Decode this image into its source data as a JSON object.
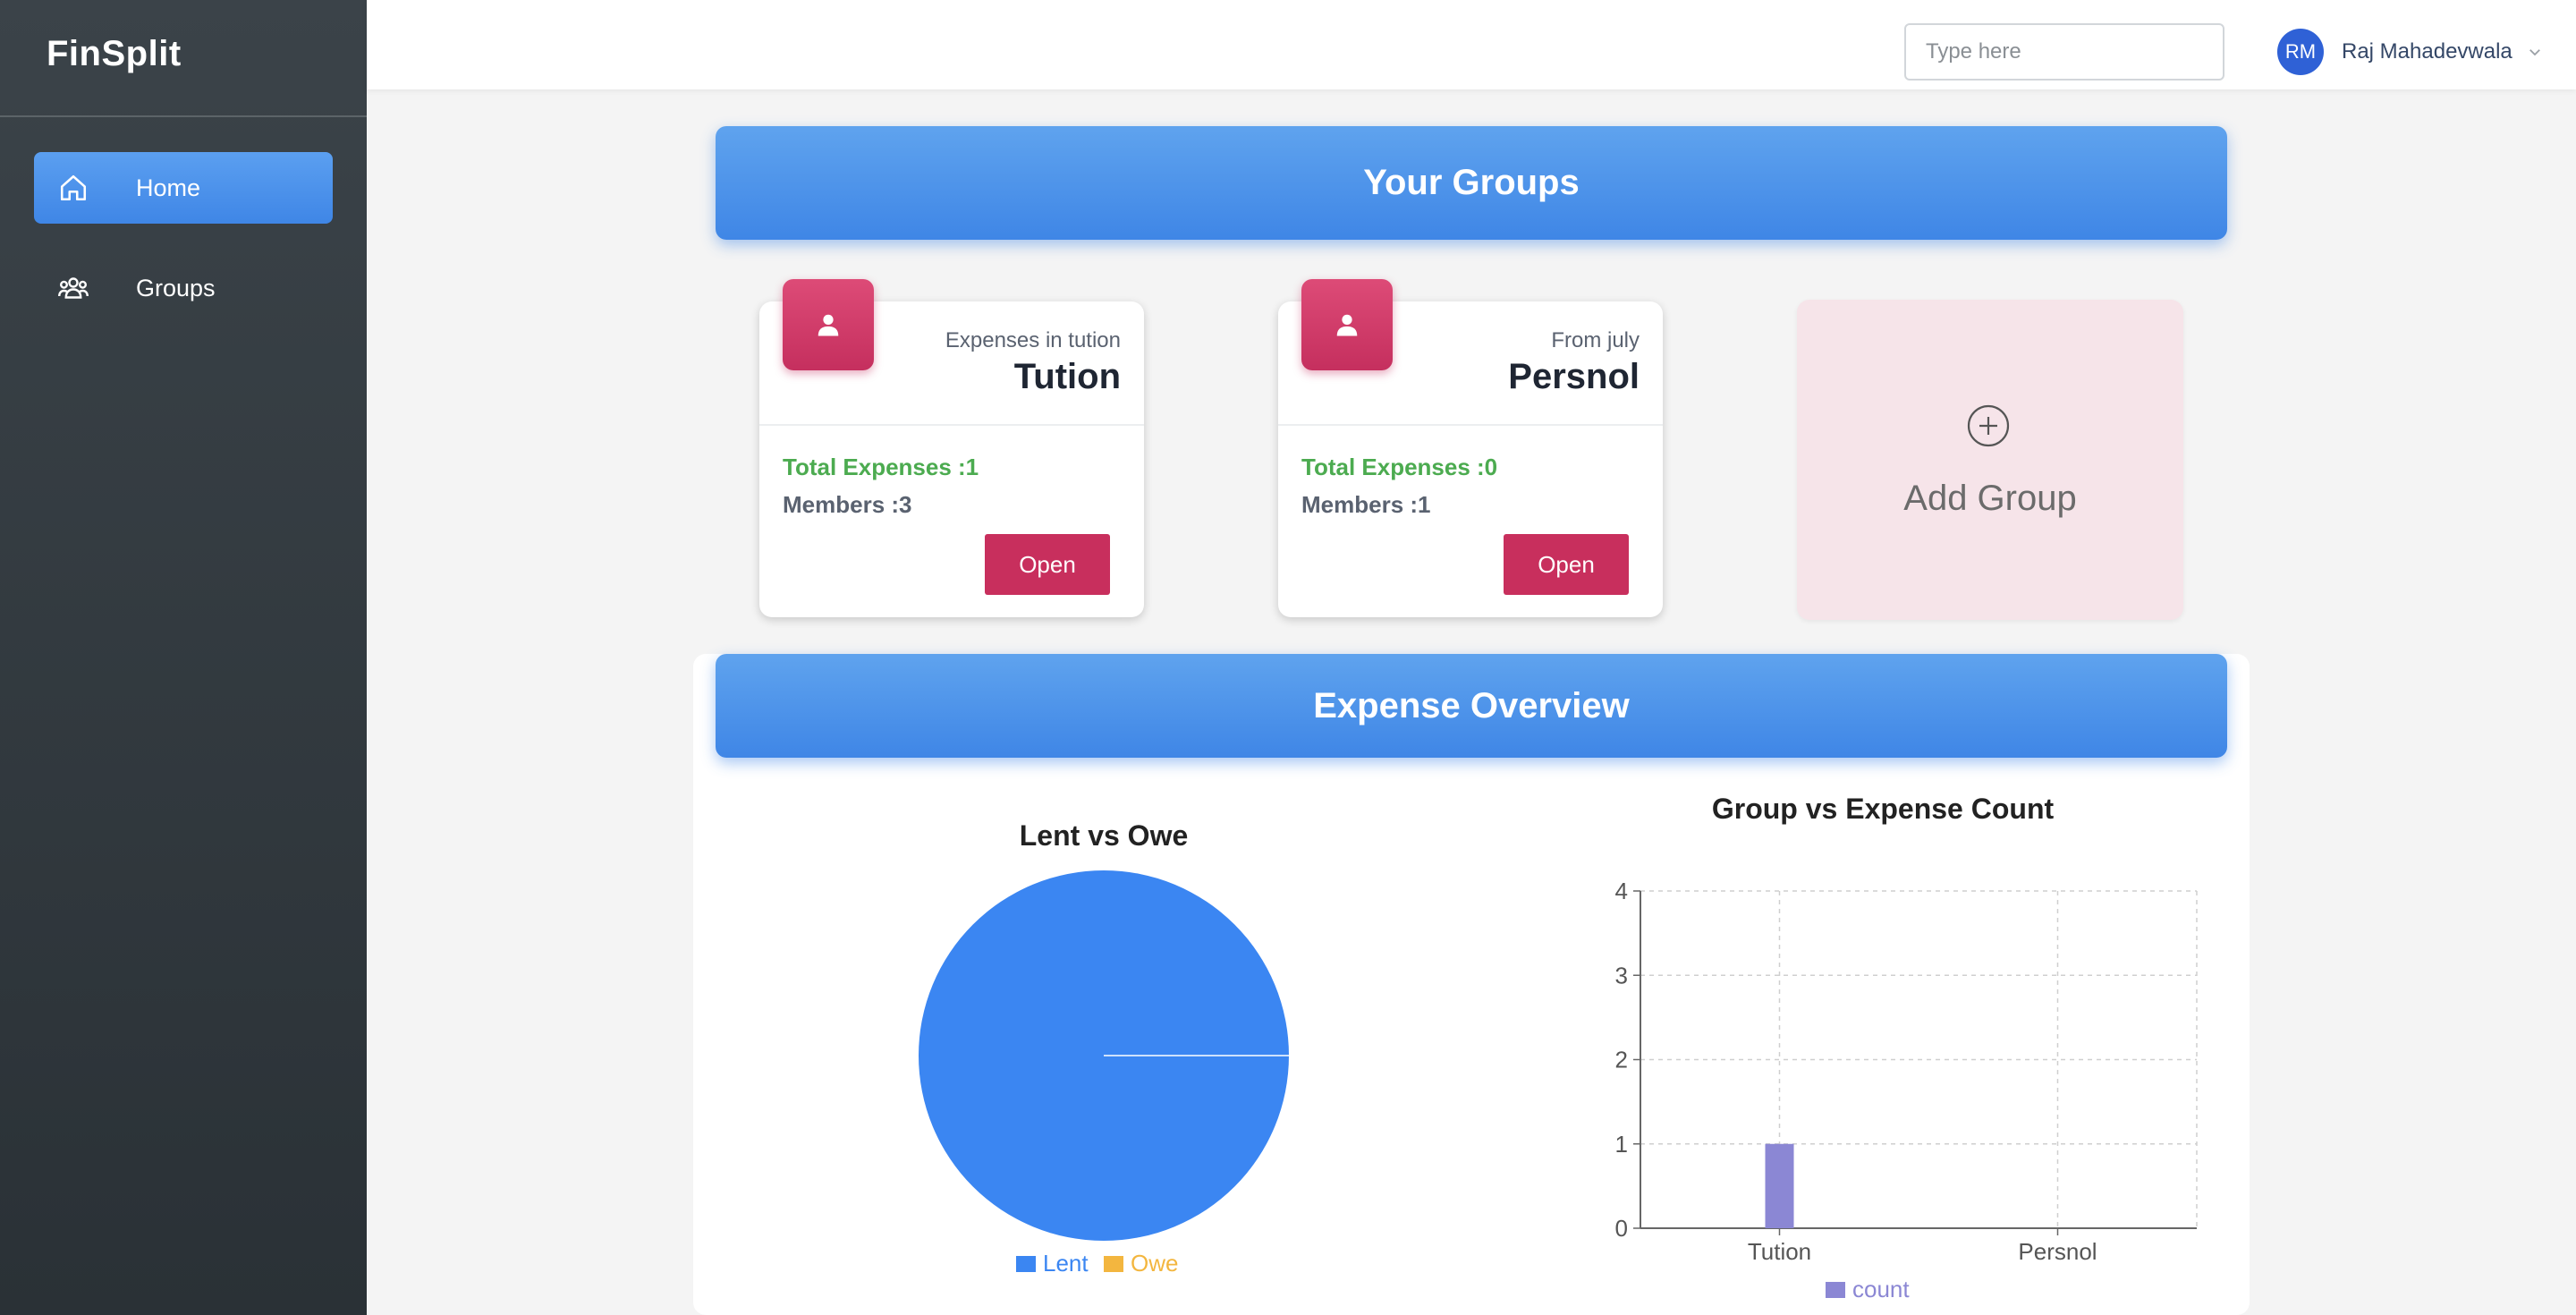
{
  "sidebar": {
    "brand": "FinSplit",
    "items": [
      {
        "label": "Home",
        "icon": "home-icon",
        "active": true
      },
      {
        "label": "Groups",
        "icon": "people-icon",
        "active": false
      }
    ]
  },
  "topbar": {
    "search_placeholder": "Type here",
    "user_initials": "RM",
    "user_name": "Raj Mahadevwala"
  },
  "groups_section": {
    "title": "Your Groups",
    "groups": [
      {
        "subtitle": "Expenses in tution",
        "name": "Tution",
        "total_expenses": "Total Expenses :1",
        "members": "Members :3",
        "open_label": "Open"
      },
      {
        "subtitle": "From july",
        "name": "Persnol",
        "total_expenses": "Total Expenses :0",
        "members": "Members :1",
        "open_label": "Open"
      }
    ],
    "add_group_label": "Add Group"
  },
  "overview": {
    "title": "Expense Overview"
  },
  "colors": {
    "accent_blue": "#3f86e6",
    "pink": "#c82f5d",
    "green": "#4cab50",
    "lent": "#3b86f2",
    "owe": "#f3b63f",
    "count_bar": "#8b87d4"
  },
  "chart_data": [
    {
      "type": "pie",
      "title": "Lent vs Owe",
      "categories": [
        "Lent",
        "Owe"
      ],
      "values": [
        1,
        0
      ],
      "legend": [
        "Lent",
        "Owe"
      ]
    },
    {
      "type": "bar",
      "title": "Group vs Expense Count",
      "categories": [
        "Tution",
        "Persnol"
      ],
      "series": [
        {
          "name": "count",
          "values": [
            1,
            0
          ]
        }
      ],
      "yticks": [
        "0",
        "1",
        "2",
        "3",
        "4"
      ],
      "ylim": [
        0,
        4
      ],
      "grid": true
    }
  ]
}
